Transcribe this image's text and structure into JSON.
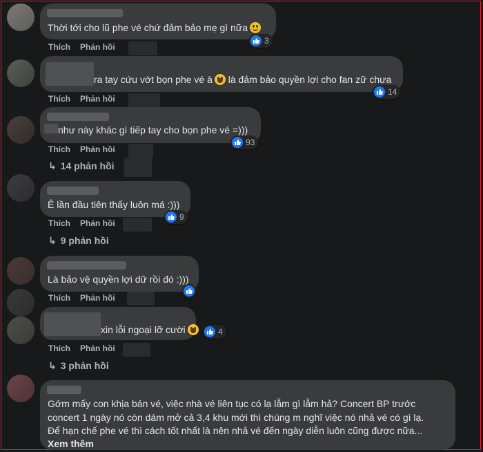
{
  "labels": {
    "like": "Thích",
    "reply": "Phản hồi"
  },
  "comments": [
    {
      "text": "Thời tới cho lũ phe vé chứ đảm bảo mẹ gì nữa",
      "reaction_count": "3"
    },
    {
      "text": "ra tay cứu vớt bọn phe vé à",
      "text2": "là đảm bảo quyền lợi cho fan zữ chưa",
      "reaction_count": "14"
    },
    {
      "text": "như này khác gì tiếp tay cho bọn phe vé =)))",
      "reaction_count": "93",
      "replies": "14 phản hồi"
    },
    {
      "text": "Ê lần đầu tiên thấy luôn má :)))",
      "reaction_count": "9",
      "replies": "9 phản hồi"
    },
    {
      "text": "Là bảo vệ quyền lợi dữ rồi đó :)))",
      "reaction_count": ""
    },
    {
      "text": "xin lỗi ngoại lỡ cười",
      "reaction_count": "4",
      "replies": "3 phản hồi"
    },
    {
      "lines": [
        "Gớm mấy con khịa bán vé, việc nhà vé liên tục có lạ lẫm gì lẫm hả? Concert BP trước",
        "concert 1 ngày nó còn dám mở cả 3,4 khu mới thì chúng m nghĩ việc nó nhả vé có gì lạ.",
        "Để hạn chế phe vé thì cách tốt nhất là nên nhả vé đến ngày diễn luôn cũng được nữa..."
      ],
      "see_more": "Xem thêm"
    }
  ],
  "colors": {
    "bubble": "#3a3b3c",
    "background": "#18191a",
    "like_blue": "#2078f4",
    "frame_red": "#d9242a"
  }
}
